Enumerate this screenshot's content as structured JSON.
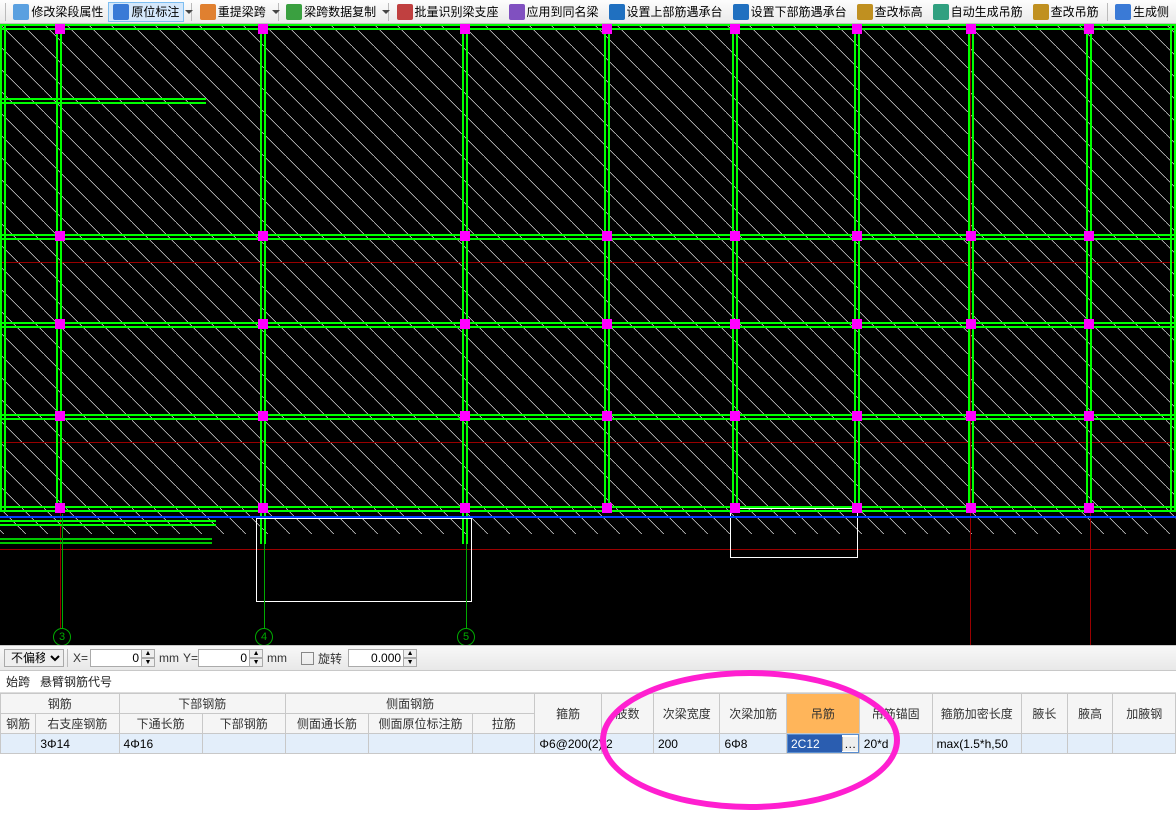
{
  "toolbar": {
    "items": [
      {
        "label": "修改梁段属性",
        "icon": "#5aa0e0",
        "name": "edit-beam-properties-button"
      },
      {
        "label": "原位标注",
        "icon": "#3a7ad6",
        "active": true,
        "name": "in-place-label-button"
      },
      {
        "label": "重提梁跨",
        "icon": "#e08030",
        "name": "repick-span-button"
      },
      {
        "label": "梁跨数据复制",
        "icon": "#3aa040",
        "name": "copy-span-data-button"
      },
      {
        "label": "批量识别梁支座",
        "icon": "#c04040",
        "name": "batch-identify-support-button"
      },
      {
        "label": "应用到同名梁",
        "icon": "#8050c0",
        "name": "apply-same-name-button"
      },
      {
        "label": "设置上部筋遇承台",
        "icon": "#2070c0",
        "name": "top-bar-cap-button"
      },
      {
        "label": "设置下部筋遇承台",
        "icon": "#2070c0",
        "name": "bottom-bar-cap-button"
      },
      {
        "label": "查改标高",
        "icon": "#c09020",
        "name": "check-elevation-button"
      },
      {
        "label": "自动生成吊筋",
        "icon": "#30a080",
        "name": "auto-gen-hanger-button"
      },
      {
        "label": "查改吊筋",
        "icon": "#c09020",
        "name": "check-hanger-button"
      },
      {
        "label": "生成侧",
        "icon": "#3a7ad6",
        "name": "generate-side-button"
      }
    ]
  },
  "axes": {
    "3": "3",
    "4": "4",
    "5": "5"
  },
  "offset": {
    "mode": "不偏移",
    "x_label": "X=",
    "x": "0",
    "mm": "mm",
    "y_label": "Y=",
    "y": "0",
    "rotate_label": "旋转",
    "rotate": "0.000"
  },
  "tabs": {
    "t1": "始跨",
    "t2": "悬臂钢筋代号"
  },
  "grid": {
    "group_headers": {
      "g1": "钢筋",
      "g2": "下部钢筋",
      "g3": "侧面钢筋"
    },
    "headers": {
      "h1": "钢筋",
      "h2": "右支座钢筋",
      "h3": "下通长筋",
      "h4": "下部钢筋",
      "h5": "侧面通长筋",
      "h6": "侧面原位标注筋",
      "h7": "拉筋",
      "h8": "箍筋",
      "h9": "肢数",
      "h10": "次梁宽度",
      "h11": "次梁加筋",
      "h12": "吊筋",
      "h13": "吊筋锚固",
      "h14": "箍筋加密长度",
      "h15": "腋长",
      "h16": "腋高",
      "h17": "加腋钢"
    },
    "row": {
      "c1": "",
      "c2": "3Φ14",
      "c3": "4Φ16",
      "c4": "",
      "c5": "",
      "c6": "",
      "c7": "",
      "c8": "Φ6@200(2)",
      "c9": "2",
      "c10": "200",
      "c11": "6Φ8",
      "c12": "2C12",
      "c13": "20*d",
      "c14": "max(1.5*h,50",
      "c15": "",
      "c16": "",
      "c17": ""
    }
  }
}
